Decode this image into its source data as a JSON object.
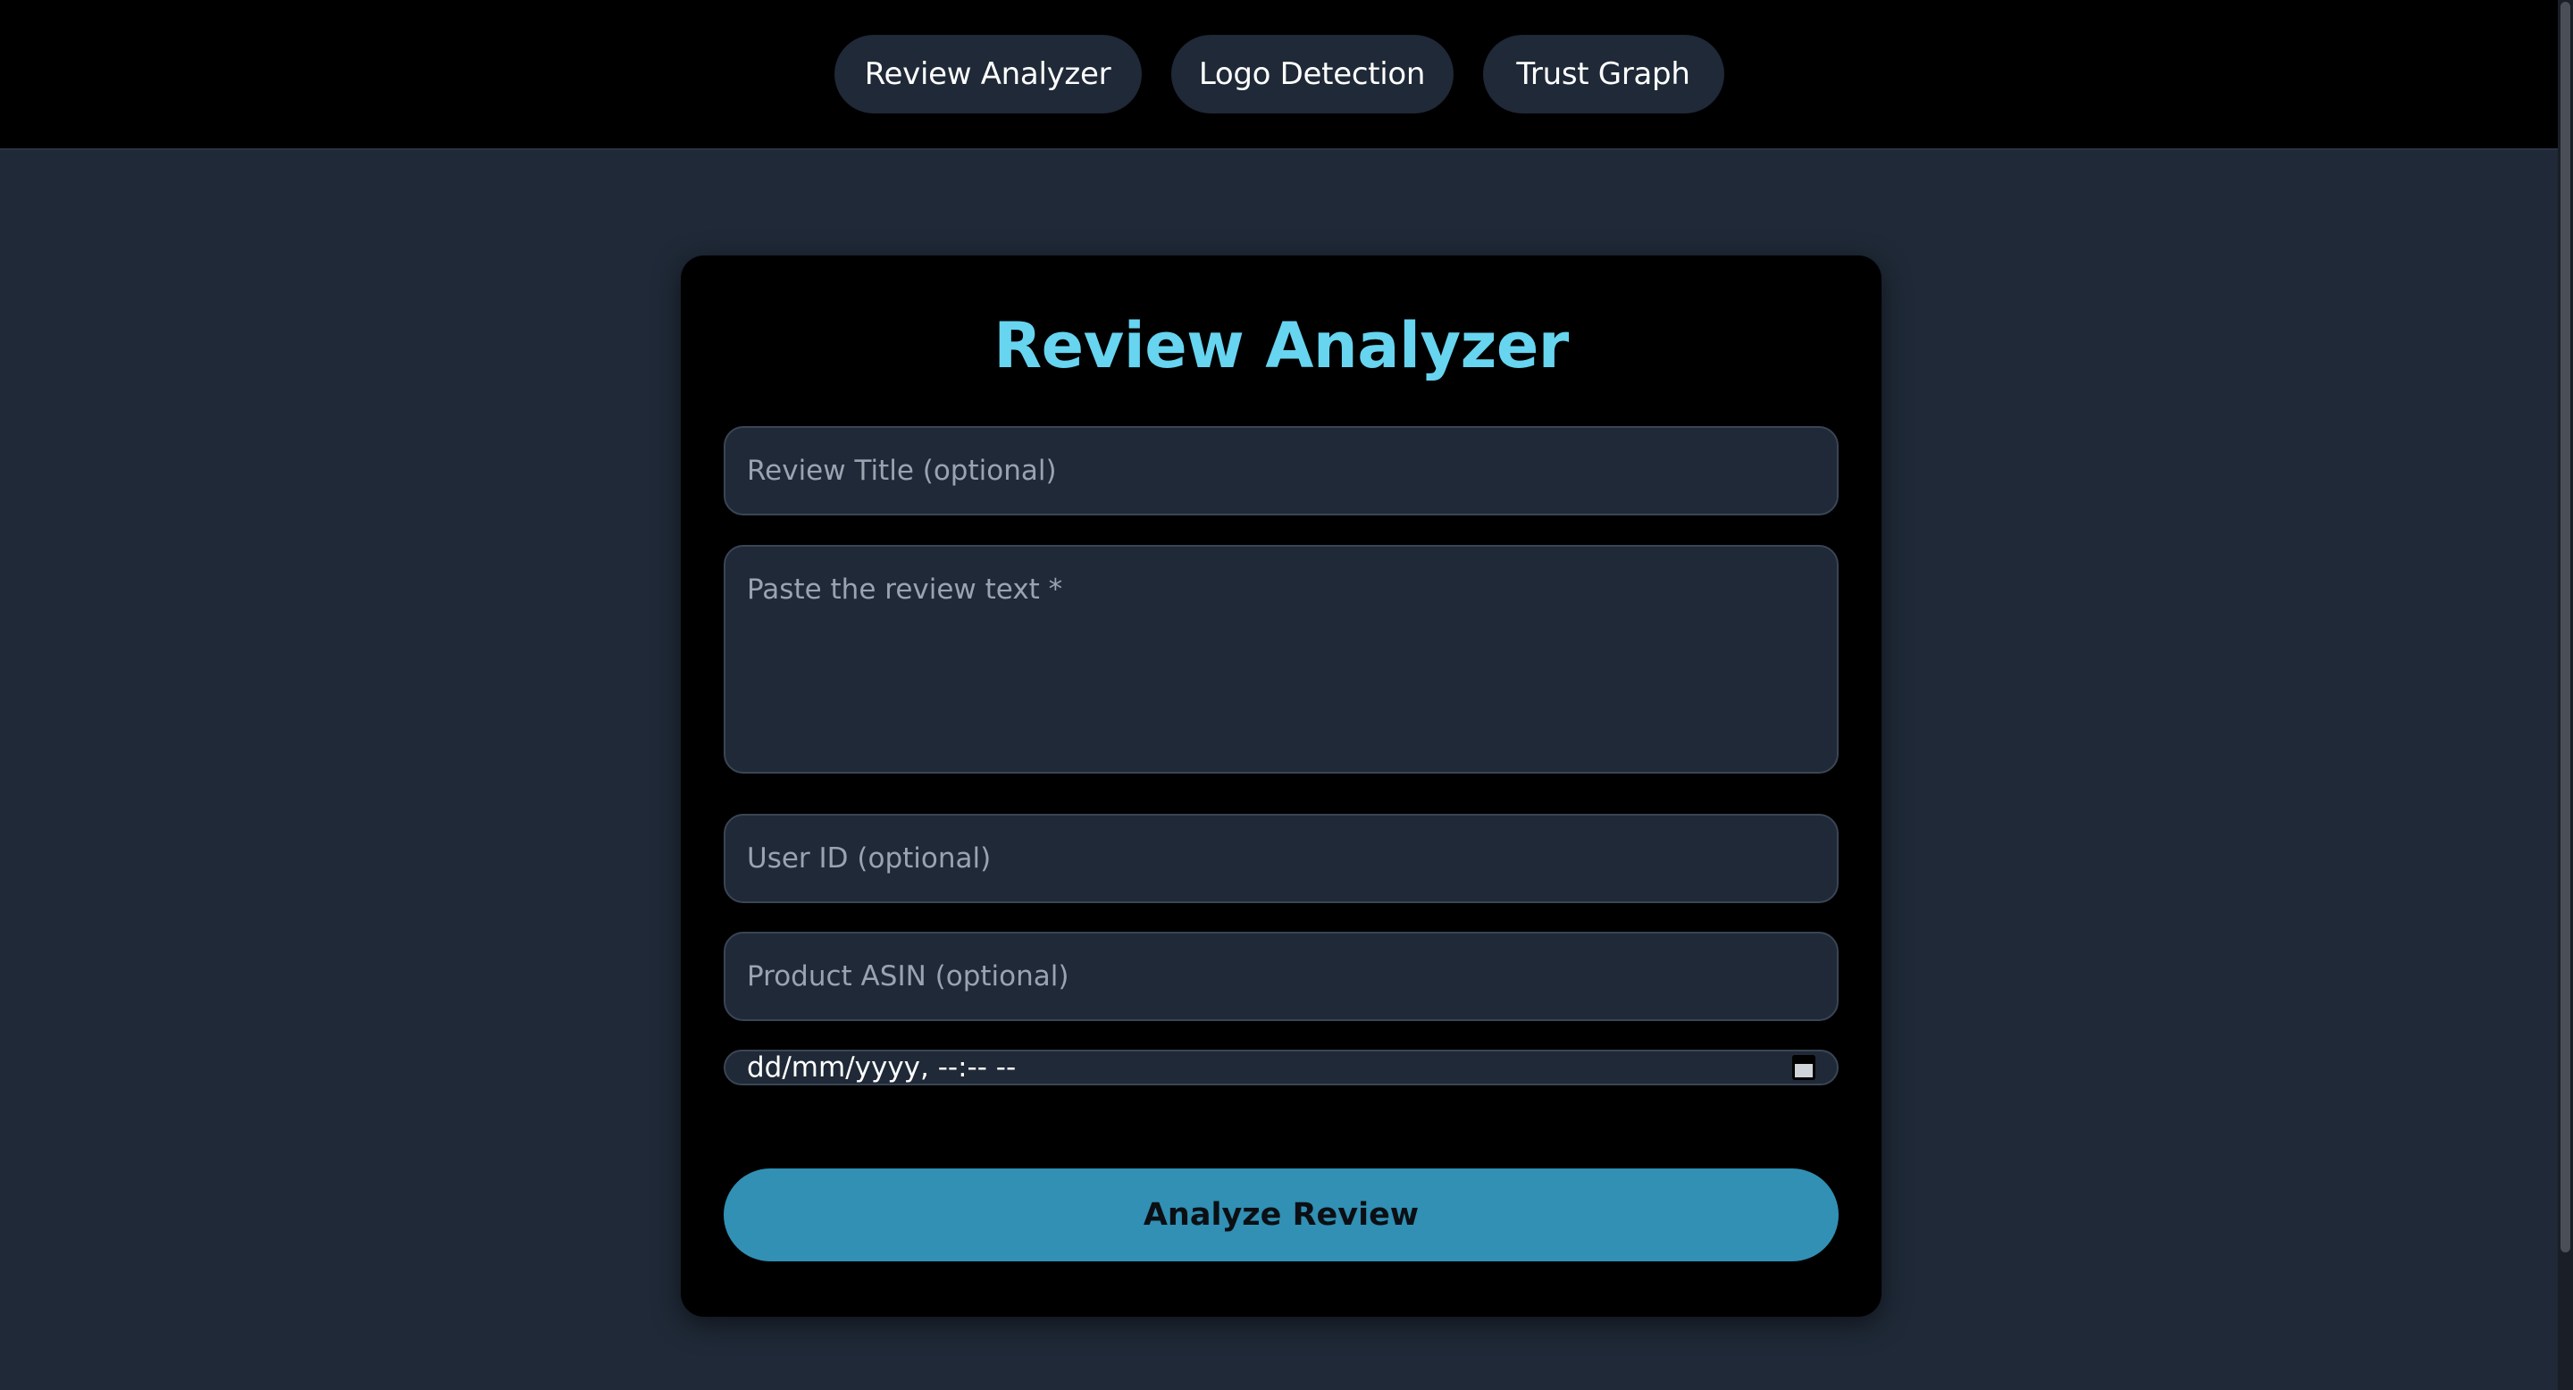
{
  "nav": {
    "tabs": [
      {
        "label": "Review Analyzer"
      },
      {
        "label": "Logo Detection"
      },
      {
        "label": "Trust Graph"
      }
    ]
  },
  "form": {
    "title": "Review Analyzer",
    "review_title": {
      "placeholder": "Review Title (optional)",
      "value": ""
    },
    "review_text": {
      "placeholder": "Paste the review text *",
      "value": ""
    },
    "user_id": {
      "placeholder": "User ID (optional)",
      "value": ""
    },
    "product_asin": {
      "placeholder": "Product ASIN (optional)",
      "value": ""
    },
    "datetime": {
      "display": "dd/mm/yyyy, --:-- --",
      "icon": "calendar-icon"
    },
    "submit_label": "Analyze Review"
  },
  "colors": {
    "background": "#1f2937",
    "nav_bar": "#000000",
    "card": "#000000",
    "title_accent": "#67d4f0",
    "button": "#3190b4"
  }
}
